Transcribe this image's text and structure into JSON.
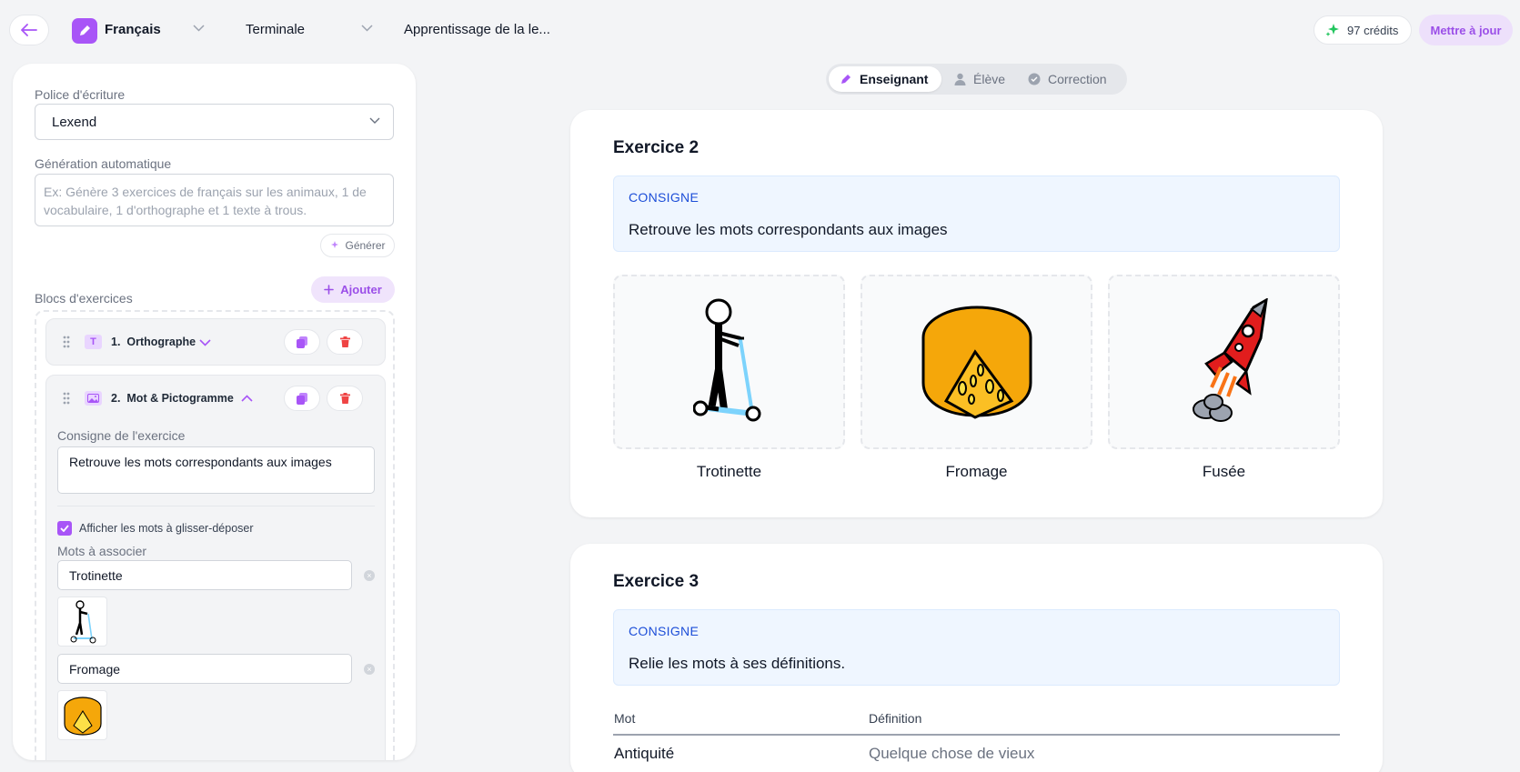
{
  "header": {
    "subject": "Français",
    "level": "Terminale",
    "doc_title": "Apprentissage de la le...",
    "credits": "97 crédits",
    "upgrade_label": "Mettre à jour"
  },
  "sidebar": {
    "font_label": "Police d'écriture",
    "font_value": "Lexend",
    "autogen_label": "Génération automatique",
    "autogen_placeholder": "Ex: Génère 3 exercices de français sur les animaux, 1 de vocabulaire, 1 d'orthographe et 1 texte à trous.",
    "generate_label": "Générer",
    "blocks_label": "Blocs d'exercices",
    "add_label": "Ajouter",
    "blocks": [
      {
        "number": "1.",
        "title": "Orthographe",
        "icon": "T"
      },
      {
        "number": "2.",
        "title": "Mot & Pictogramme",
        "consigne_label": "Consigne de l'exercice",
        "consigne_value": "Retrouve les mots correspondants aux images",
        "checkbox_label": "Afficher les mots à glisser-déposer",
        "words_label": "Mots à associer",
        "words": [
          "Trotinette",
          "Fromage"
        ]
      }
    ]
  },
  "modes": [
    {
      "label": "Enseignant",
      "icon": "pencil-icon",
      "active": true
    },
    {
      "label": "Élève",
      "icon": "user-icon",
      "active": false
    },
    {
      "label": "Correction",
      "icon": "check-circle-icon",
      "active": false
    }
  ],
  "exercises": [
    {
      "title": "Exercice 2",
      "consigne_tag": "CONSIGNE",
      "consigne": "Retrouve les mots correspondants aux images",
      "images": [
        {
          "caption": "Trotinette",
          "icon": "scooter-picto"
        },
        {
          "caption": "Fromage",
          "icon": "cheese-picto"
        },
        {
          "caption": "Fusée",
          "icon": "rocket-picto"
        }
      ]
    },
    {
      "title": "Exercice 3",
      "consigne_tag": "CONSIGNE",
      "consigne": "Relie les mots à ses définitions.",
      "table": {
        "headers": [
          "Mot",
          "Définition"
        ],
        "rows": [
          [
            "Antiquité",
            "Quelque chose de vieux"
          ]
        ]
      }
    }
  ],
  "colors": {
    "accent": "#a855f7",
    "danger": "#ef4444",
    "consigne_bg": "#eff6ff",
    "consigne_text": "#1d4ed8"
  }
}
